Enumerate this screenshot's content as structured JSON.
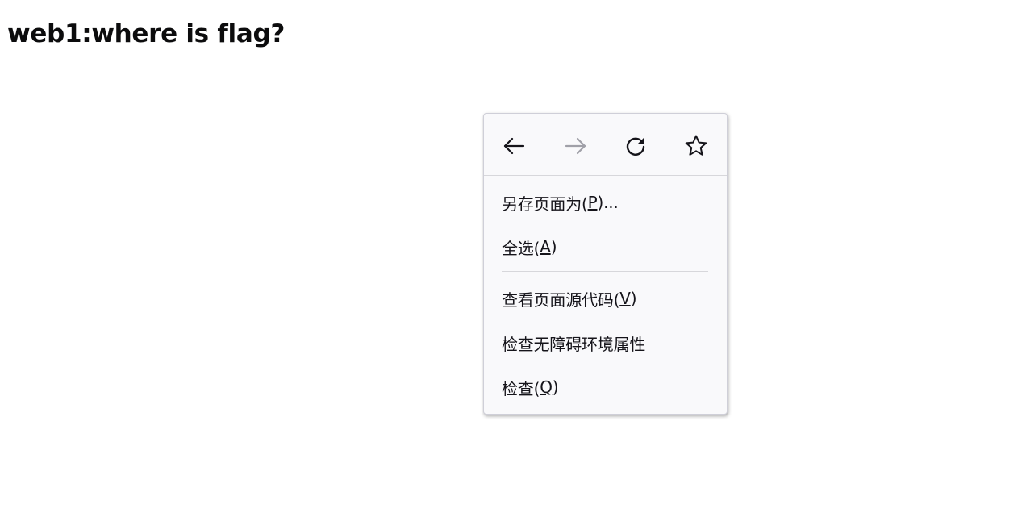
{
  "page": {
    "heading": "web1:where is flag?"
  },
  "context_menu": {
    "nav": {
      "back_icon": "arrow-left",
      "forward_icon": "arrow-right",
      "reload_icon": "reload",
      "bookmark_icon": "star-outline",
      "forward_enabled": false
    },
    "items": [
      {
        "prefix": "另存页面为(",
        "accel": "P",
        "suffix": ")..."
      },
      {
        "prefix": "全选(",
        "accel": "A",
        "suffix": ")"
      },
      {
        "prefix": "查看页面源代码(",
        "accel": "V",
        "suffix": ")"
      },
      {
        "prefix": "检查无障碍环境属性",
        "accel": "",
        "suffix": ""
      },
      {
        "prefix": "检查(",
        "accel": "Q",
        "suffix": ")"
      }
    ]
  },
  "colors": {
    "menu_background": "#f9f9fb",
    "menu_text": "#15141a",
    "disabled_icon": "#a0a0a8",
    "separator": "#d7d7db"
  }
}
